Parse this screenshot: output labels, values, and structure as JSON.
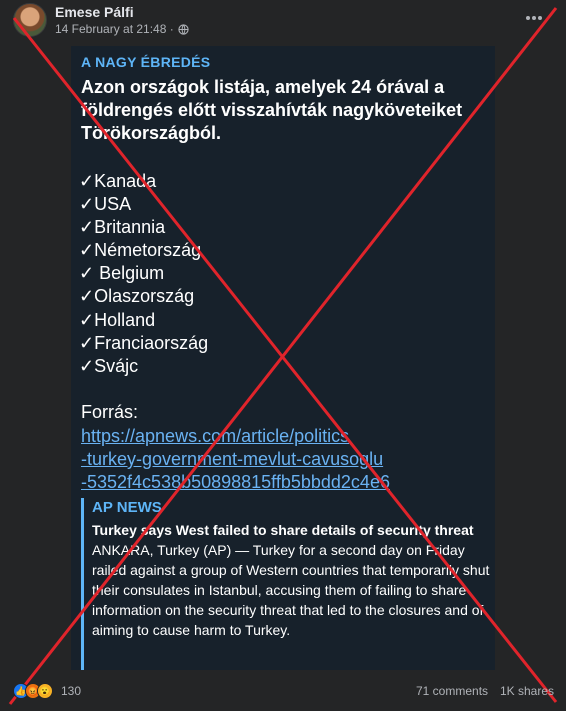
{
  "post": {
    "author": "Emese Pálfi",
    "timestamp": "14 February at 21:48 ·"
  },
  "telegram": {
    "channel": "A NAGY ÉBREDÉS",
    "headline": "Azon országok listája, amelyek 24 órával a földrengés előtt visszahívták nagyköveteiket Törökországból.",
    "countries": [
      "✓Kanada",
      "✓USA",
      "✓Britannia",
      "✓Németország",
      "✓ Belgium",
      "✓Olaszország",
      "✓Holland",
      "✓Franciaország",
      "✓Svájc"
    ],
    "source_label": "Forrás:",
    "link_lines": [
      "https://apnews.com/article/politics",
      "-turkey-government-mevlut-cavusoglu",
      "-5352f4c538b50898815ffb5bbdd2c4e6"
    ],
    "preview": {
      "site": "AP NEWS",
      "title": "Turkey says West failed to share details of security threat",
      "body": "ANKARA, Turkey (AP) — Turkey for a second day on Friday railed against a group of Western countries that temporarily shut their consulates in Istanbul, accusing them of failing to share information on the security threat that led to the closures and of aiming to cause harm to Turkey."
    }
  },
  "footer": {
    "reaction_count": "130",
    "comments": "71 comments",
    "shares": "1K shares"
  },
  "colors": {
    "background": "#242526",
    "card_background": "#17212b",
    "accent": "#5eb5f7",
    "cross": "#e0242b"
  }
}
